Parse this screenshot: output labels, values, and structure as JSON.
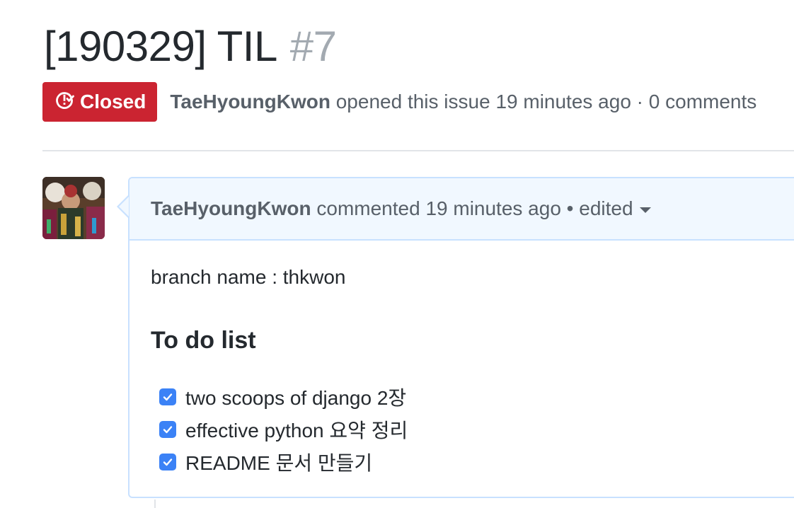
{
  "issue": {
    "title": "[190329] TIL",
    "number": "#7",
    "state": "Closed",
    "state_icon": "issue-closed-icon",
    "author": "TaeHyoungKwon",
    "opened_text": " opened this issue 19 minutes ago · 0 comments"
  },
  "comment": {
    "author": "TaeHyoungKwon",
    "commented_text": " commented 19 minutes ago",
    "separator": " • ",
    "edited_label": "edited",
    "body": {
      "branch_line": "branch name : thkwon",
      "heading": "To do list",
      "tasks": [
        {
          "label": "two scoops of django 2장",
          "checked": true
        },
        {
          "label": "effective python 요약 정리",
          "checked": true
        },
        {
          "label": "README 문서 만들기",
          "checked": true
        }
      ]
    }
  },
  "colors": {
    "closed_red": "#cb2431",
    "header_bg": "#f1f8ff",
    "header_border": "#c8e1ff",
    "checkbox_blue": "#3b82f6",
    "muted_text": "#586069",
    "number_gray": "#a3aab1"
  }
}
